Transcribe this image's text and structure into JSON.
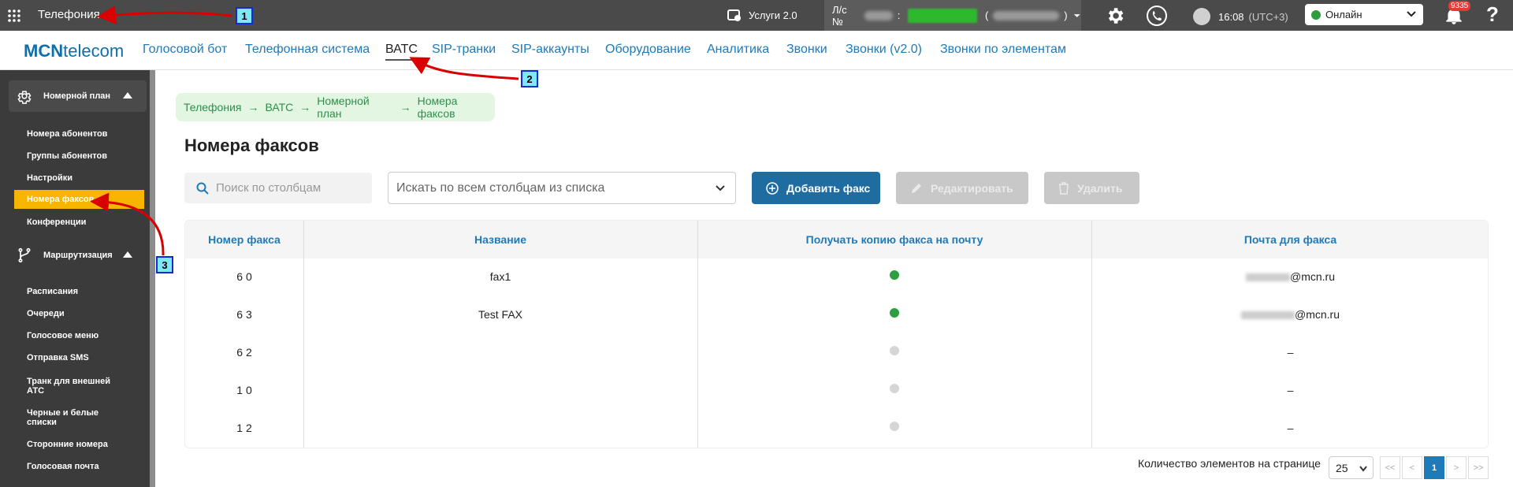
{
  "topbar": {
    "app_title": "Телефония",
    "services_label": "Услуги 2.0",
    "account_prefix": "Л/с №",
    "account_sep": ":",
    "account_paren_open": "(",
    "account_paren_close": ")",
    "time": "16:08",
    "timezone": "(UTC+3)",
    "status": "Онлайн",
    "notifications_count": "9335",
    "help": "?"
  },
  "nav": {
    "logo_bold": "MCN",
    "logo_rest": "telecom",
    "items": [
      "Голосовой бот",
      "Телефонная система",
      "ВАТС",
      "SIP-транки",
      "SIP-аккаунты",
      "Оборудование",
      "Аналитика",
      "Звонки",
      "Звонки (v2.0)",
      "Звонки по элементам"
    ],
    "active": "ВАТС"
  },
  "sidebar": {
    "group1": "Номерной план",
    "group1_items": [
      "Номера абонентов",
      "Группы абонентов",
      "Настройки",
      "Номера факсов",
      "Конференции"
    ],
    "group2": "Маршрутизация",
    "group2_items": [
      "Расписания",
      "Очереди",
      "Голосовое меню",
      "Отправка SMS",
      "Транк для внешней",
      "АТС",
      "Черные и белые",
      "списки",
      "Сторонние номера",
      "Голосовая почта"
    ]
  },
  "breadcrumbs": [
    "Телефония",
    "ВАТС",
    "Номерной план",
    "Номера факсов"
  ],
  "breadcrumb_sep": "→",
  "page_title": "Номера факсов",
  "search": {
    "placeholder": "Поиск по столбцам"
  },
  "column_select": "Искать по всем столбцам из списка",
  "buttons": {
    "add": "Добавить факс",
    "edit": "Редактировать",
    "delete": "Удалить"
  },
  "table": {
    "headers": [
      "Номер факса",
      "Название",
      "Получать копию факса на почту",
      "Почта для факса"
    ],
    "rows": [
      {
        "number": "6 0",
        "name": "fax1",
        "copy": true,
        "email": "@mcn.ru"
      },
      {
        "number": "6 3",
        "name": "Test FAX",
        "copy": true,
        "email": "@mcn.ru"
      },
      {
        "number": "6 2",
        "name": "",
        "copy": false,
        "email": "–"
      },
      {
        "number": "1 0",
        "name": "",
        "copy": false,
        "email": "–"
      },
      {
        "number": "1 2",
        "name": "",
        "copy": false,
        "email": "–"
      }
    ]
  },
  "footer": {
    "per_page_label": "Количество элементов на странице",
    "per_page": "25",
    "pages": [
      "<<",
      "<",
      "1",
      ">",
      ">>"
    ],
    "current_page": "1"
  },
  "annotations": [
    "1",
    "2",
    "3"
  ],
  "colors": {
    "accent": "#1f7ab8",
    "active_item": "#f7b500",
    "dot_on": "#2e9e3e",
    "dot_off": "#d6d6d6"
  }
}
